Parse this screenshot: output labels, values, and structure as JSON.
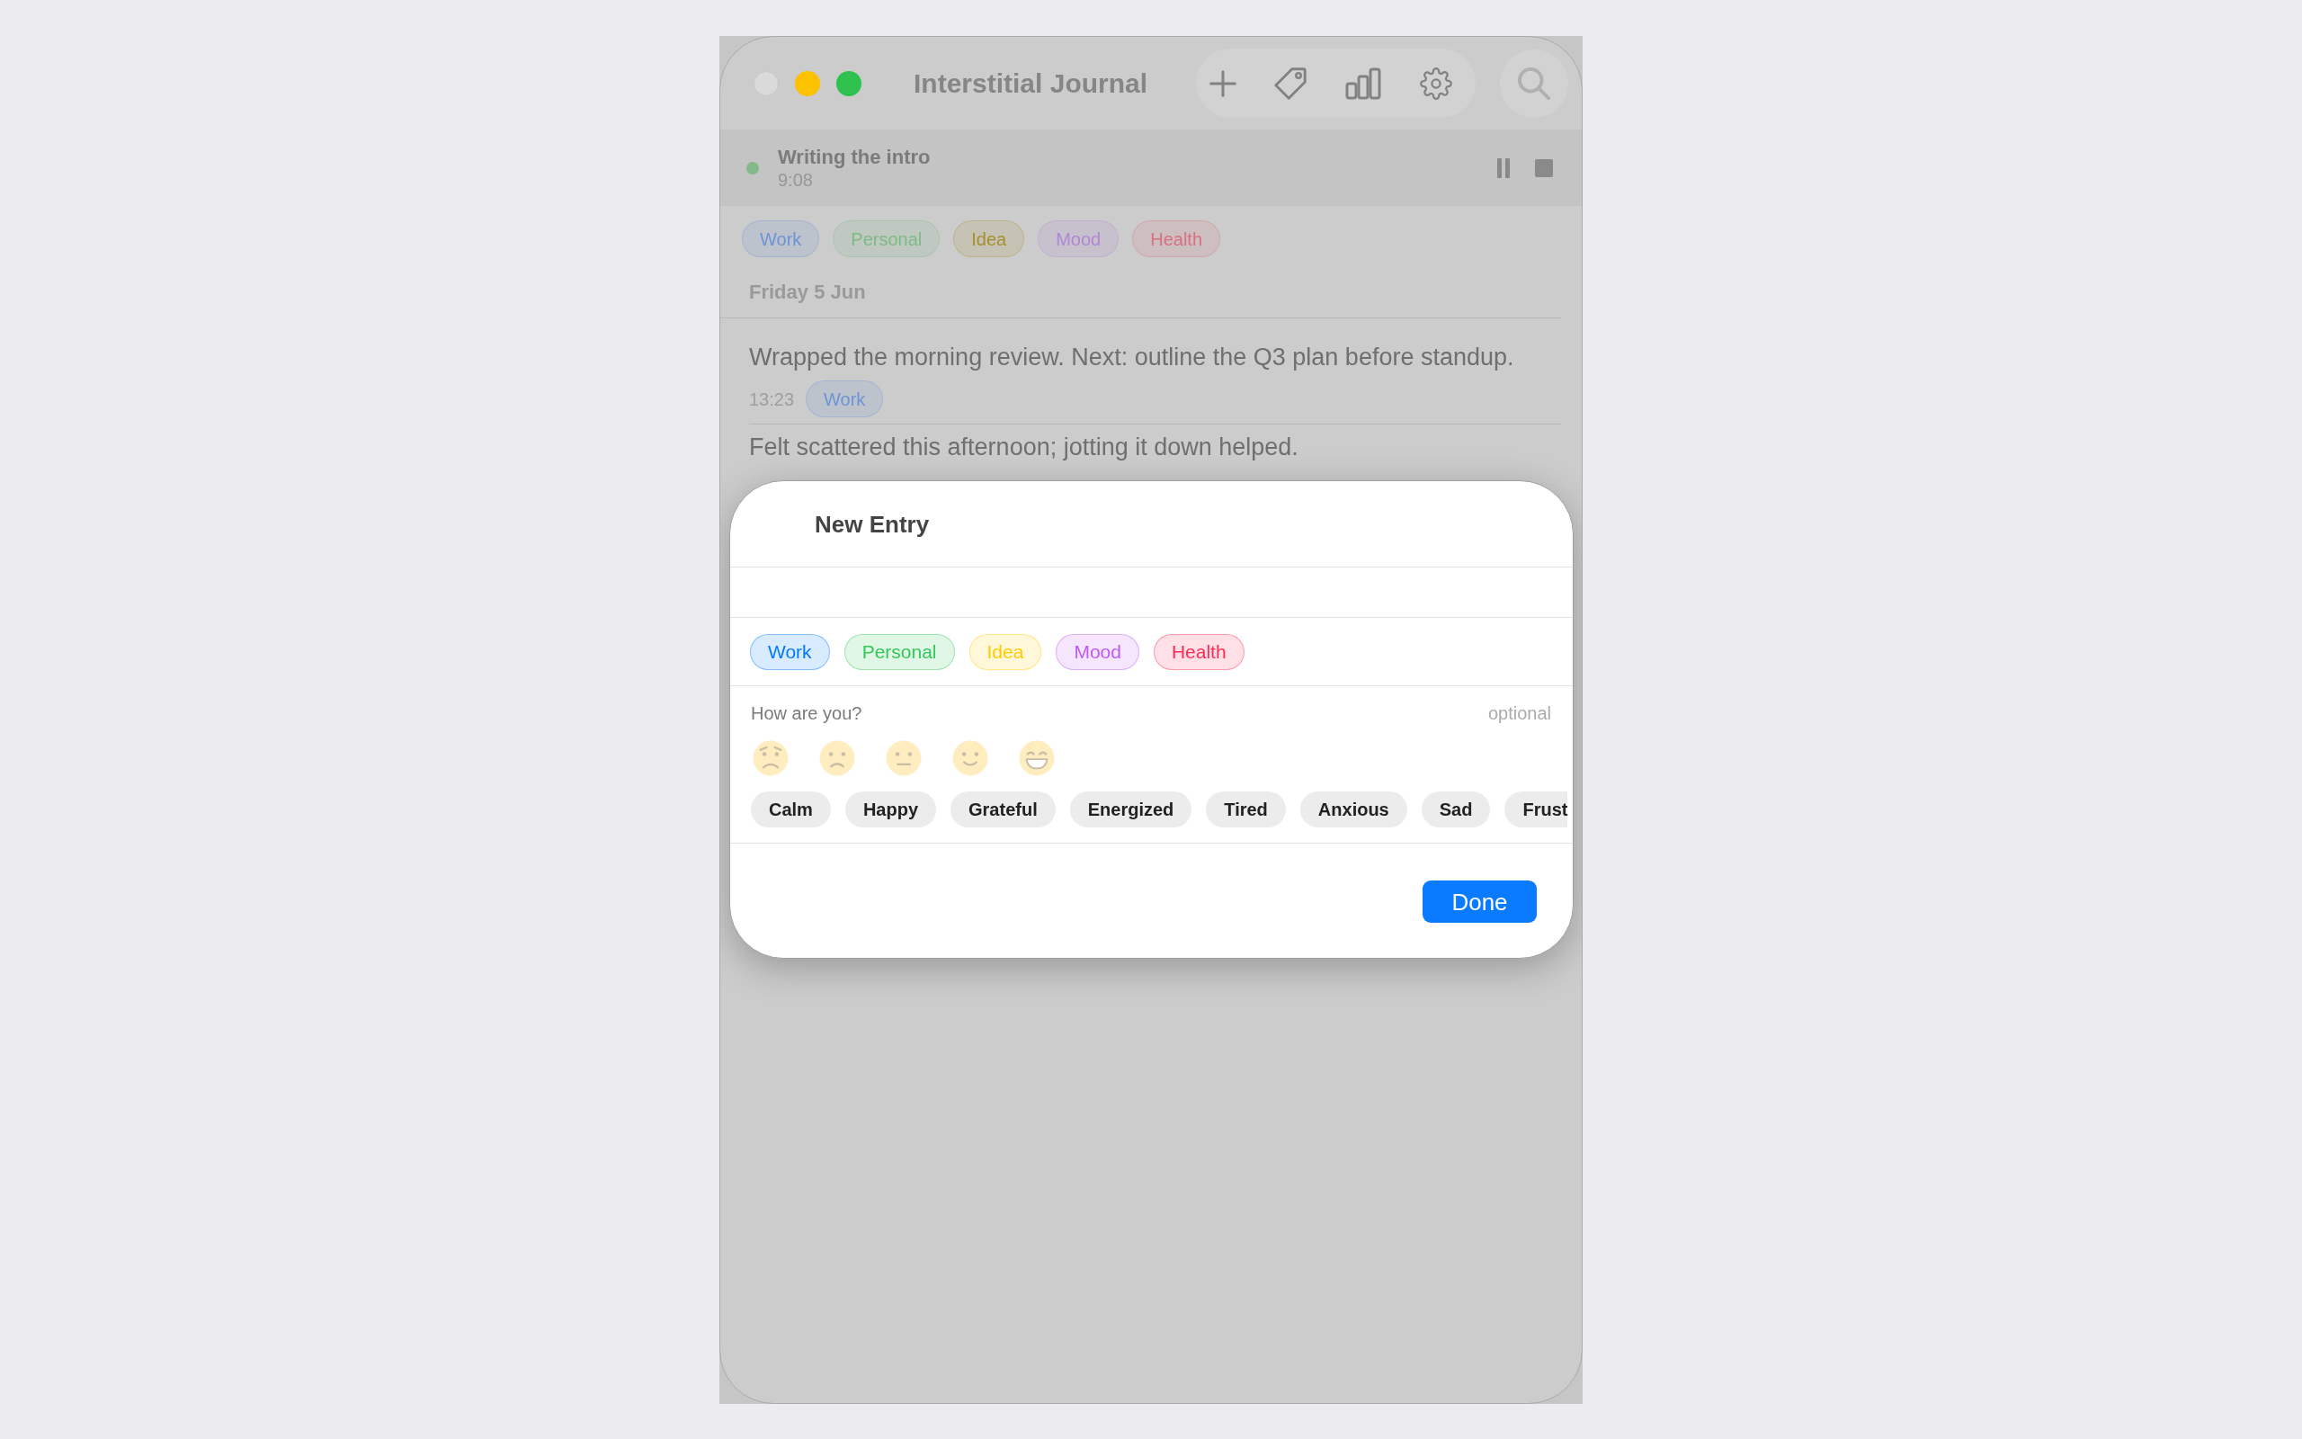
{
  "window": {
    "title": "Interstitial Journal",
    "controls": [
      {
        "kind": "close",
        "disabled": true
      },
      {
        "kind": "minimize",
        "disabled": false
      },
      {
        "kind": "zoom",
        "disabled": false
      }
    ]
  },
  "timer": {
    "title": "Writing the intro",
    "elapsed": "9:08",
    "running": true
  },
  "tag_filters": [
    {
      "label": "Work",
      "color": "#6d93d4"
    },
    {
      "label": "Personal",
      "color": "#7dba84"
    },
    {
      "label": "Idea",
      "color": "#a88f2e"
    },
    {
      "label": "Mood",
      "color": "#b186d4"
    },
    {
      "label": "Health",
      "color": "#d97080"
    }
  ],
  "day": {
    "heading": "Friday 5 Jun",
    "entries": [
      {
        "text": "Wrapped the morning review. Next: outline the Q3 plan before standup.",
        "time": "13:23",
        "tags": [
          {
            "label": "Work",
            "color": "#6d93d4"
          }
        ]
      },
      {
        "text": "Felt scattered this afternoon; jotting it down helped."
      }
    ]
  },
  "new_entry": {
    "title": "New Entry",
    "tags": [
      {
        "label": "Work",
        "color": "#007aff",
        "selected": false
      },
      {
        "label": "Personal",
        "color": "#34c759",
        "selected": false
      },
      {
        "label": "Idea",
        "color": "#ffcc00",
        "selected": false
      },
      {
        "label": "Mood",
        "color": "#bf5af2",
        "selected": false
      },
      {
        "label": "Health",
        "color": "#ff2d55",
        "selected": false
      }
    ],
    "mood_prompt": "How are you?",
    "mood_hint": "optional",
    "moods": [
      {
        "kind": "worried",
        "selected": false
      },
      {
        "kind": "frowning",
        "selected": false
      },
      {
        "kind": "neutral",
        "selected": false
      },
      {
        "kind": "smiling",
        "selected": false
      },
      {
        "kind": "grinning",
        "selected": false
      }
    ],
    "feelings": [
      {
        "label": "Calm",
        "selected": false
      },
      {
        "label": "Happy",
        "selected": false
      },
      {
        "label": "Grateful",
        "selected": false
      },
      {
        "label": "Energized",
        "selected": false
      },
      {
        "label": "Tired",
        "selected": false
      },
      {
        "label": "Anxious",
        "selected": false
      },
      {
        "label": "Sad",
        "selected": false
      },
      {
        "label": "Frust",
        "selected": false
      }
    ],
    "done_button": "Done"
  }
}
